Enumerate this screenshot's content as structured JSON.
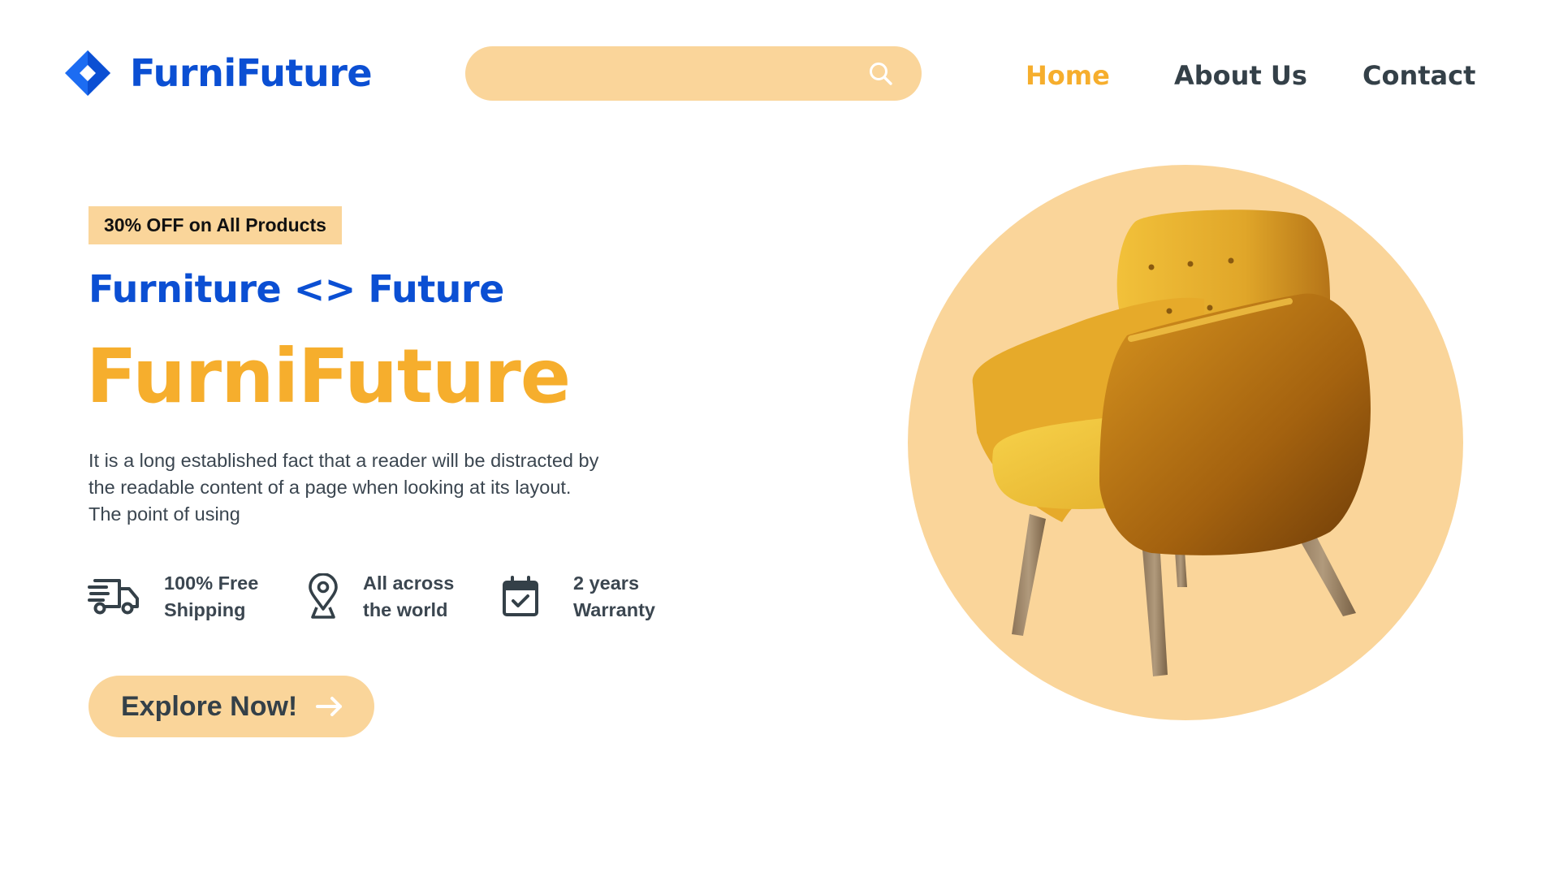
{
  "brand": {
    "name": "FurniFuture",
    "logo_icon": "diamond-logo-icon",
    "color": "#0b4fd3"
  },
  "search": {
    "placeholder": "",
    "value": "",
    "icon": "search-icon"
  },
  "nav": {
    "items": [
      {
        "label": "Home",
        "active": true
      },
      {
        "label": "About Us",
        "active": false
      },
      {
        "label": "Contact",
        "active": false
      }
    ]
  },
  "hero": {
    "badge": "30% OFF on All Products",
    "tagline": "Furniture <> Future",
    "title": "FurniFuture",
    "description_lines": [
      "It is a long established fact that a reader will be distracted by",
      "the readable content of a page when looking at its layout.",
      "The point of using"
    ],
    "features": [
      {
        "icon": "delivery-truck-icon",
        "lines": [
          "100% Free",
          "Shipping"
        ]
      },
      {
        "icon": "location-pin-icon",
        "lines": [
          "All across",
          "the world"
        ]
      },
      {
        "icon": "calendar-check-icon",
        "lines": [
          "2 years",
          "Warranty"
        ]
      }
    ],
    "cta": {
      "label": "Explore Now!",
      "icon": "arrow-right-icon"
    },
    "image": {
      "subject": "yellow-armchair",
      "icon": "armchair-image"
    }
  },
  "colors": {
    "accent": "#f6ae2d",
    "peach": "#fad59a",
    "primary_blue": "#0b4fd3",
    "text_dark": "#344048"
  }
}
